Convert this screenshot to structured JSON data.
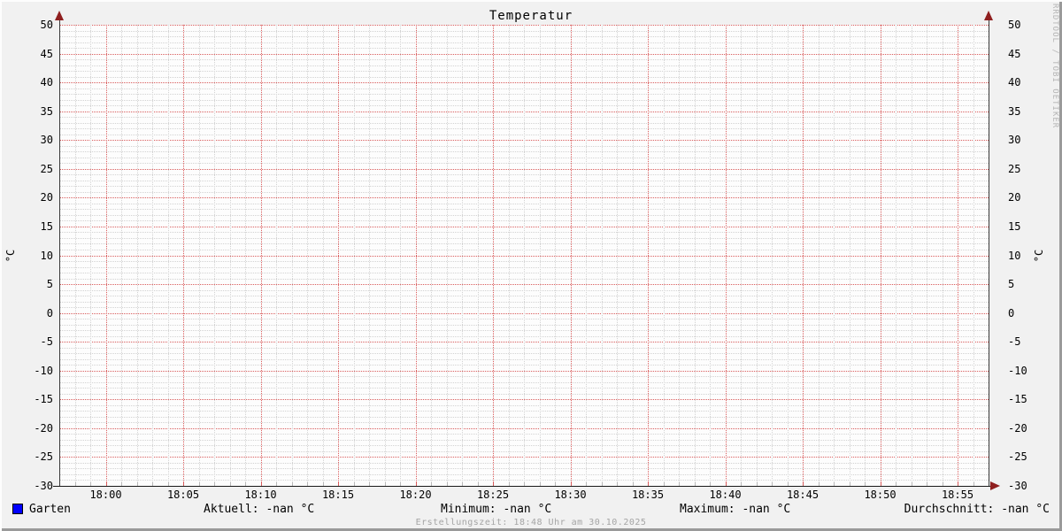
{
  "title": "Temperatur",
  "axis": {
    "unit_left": "°C",
    "unit_right": "°C"
  },
  "watermark": "RRDTOOL / TOBI OETIKER",
  "legend": {
    "series_label": "Garten",
    "series_color": "#0000ff"
  },
  "stats_row": [
    "Aktuell: -nan °C",
    "Minimum: -nan °C",
    "Maximum: -nan °C",
    "Durchschnitt: -nan °C"
  ],
  "footer": "Erstellungszeit: 18:48 Uhr am 30.10.2025",
  "chart_data": {
    "type": "line",
    "title": "Temperatur",
    "ylabel": "°C",
    "ylim": [
      -30,
      50
    ],
    "y_major_step": 5,
    "y_minor_step": 1,
    "yticks": [
      50,
      45,
      40,
      35,
      30,
      25,
      20,
      15,
      10,
      5,
      0,
      -5,
      -10,
      -15,
      -20,
      -25,
      -30
    ],
    "x_domain": [
      "17:57",
      "18:57"
    ],
    "x_minor_step_minutes": 1,
    "x_major_step_minutes": 5,
    "xticks": [
      "18:00",
      "18:05",
      "18:10",
      "18:15",
      "18:20",
      "18:25",
      "18:30",
      "18:35",
      "18:40",
      "18:45",
      "18:50",
      "18:55"
    ],
    "series": [
      {
        "name": "Garten",
        "color": "#0000ff",
        "values": []
      }
    ],
    "stats": {
      "aktuell": "-nan °C",
      "minimum": "-nan °C",
      "maximum": "-nan °C",
      "durchschnitt": "-nan °C"
    },
    "grid": {
      "major_color": "#d95c5c",
      "minor_color": "#d2d2d2",
      "grid_on": true
    },
    "legend_position": "bottom"
  }
}
